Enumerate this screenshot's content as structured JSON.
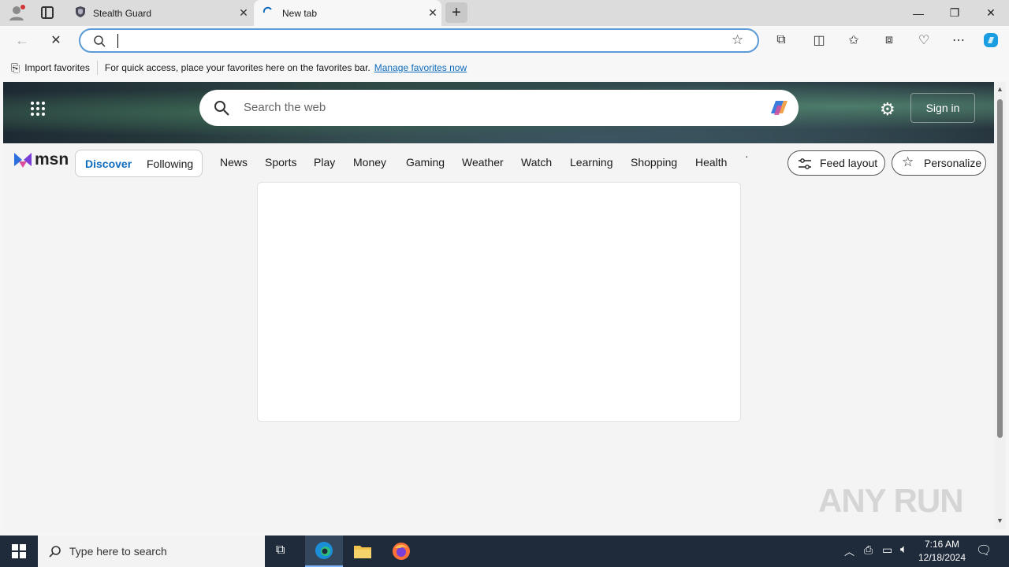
{
  "browser": {
    "tabs": [
      {
        "title": "Stealth Guard",
        "icon": "shield-icon",
        "active": false
      },
      {
        "title": "New tab",
        "icon": "loading-spinner-icon",
        "active": true
      }
    ],
    "address_value": "",
    "favorites_bar": {
      "import_label": "Import favorites",
      "hint": "For quick access, place your favorites here on the favorites bar.",
      "manage_link": "Manage favorites now"
    }
  },
  "msn": {
    "search_placeholder": "Search the web",
    "sign_in_label": "Sign in",
    "logo_text": "msn",
    "feed_tabs": [
      "Discover",
      "Following"
    ],
    "nav": [
      "News",
      "Sports",
      "Play",
      "Money",
      "Gaming",
      "Weather",
      "Watch",
      "Learning",
      "Shopping",
      "Health"
    ],
    "feed_layout_label": "Feed layout",
    "personalize_label": "Personalize"
  },
  "watermark": "ANY RUN",
  "taskbar": {
    "search_placeholder": "Type here to search",
    "time": "7:16 AM",
    "date": "12/18/2024"
  },
  "colors": {
    "accent": "#0f6cbd",
    "taskbar": "#1f2b3a"
  }
}
